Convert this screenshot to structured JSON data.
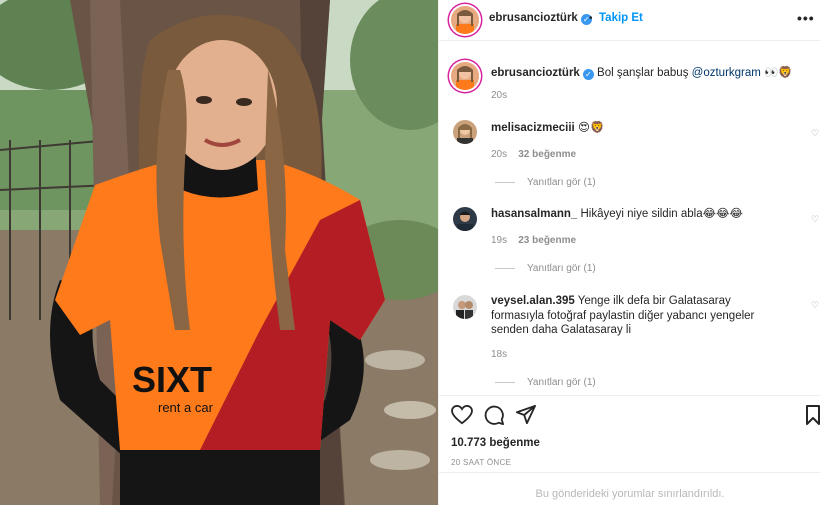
{
  "post": {
    "author": "ebrusancioztürk",
    "dot": "•",
    "follow_label": "Takip Et",
    "more": "•••"
  },
  "caption": {
    "username": "ebrusancioztürk",
    "text": "Bol şanşlar babuş",
    "mention": "@ozturkgram",
    "emojis": "👀🦁",
    "time": "20s"
  },
  "comments": [
    {
      "username": "melisacizmeciii",
      "text": "😍🦁",
      "time": "20s",
      "likes": "32 beğenme",
      "replies": "Yanıtları gör (1)"
    },
    {
      "username": "hasansalmann_",
      "text": "Hikâyeyi niye sildin abla😂😂😂",
      "time": "19s",
      "likes": "23 beğenme",
      "replies": "Yanıtları gör (1)"
    },
    {
      "username": "veysel.alan.395",
      "text": "Yenge ilk defa bir Galatasaray formasıyla fotoğraf paylastin diğer yabancı yengeler senden daha Galatasaray li",
      "time": "18s",
      "replies": "Yanıtları gör (1)"
    }
  ],
  "likes_count": "10.773 beğenme",
  "posted_ago": "20 SAAT ÖNCE",
  "footer_text": "Bu gönderideki yorumlar sınırlandırıldı.",
  "shirt_brand": "SIXT",
  "shirt_sub": "rent a car",
  "colors": {
    "accent": "#0095f6",
    "shirt_orange": "#ff7a1a",
    "shirt_red": "#b51d25"
  }
}
